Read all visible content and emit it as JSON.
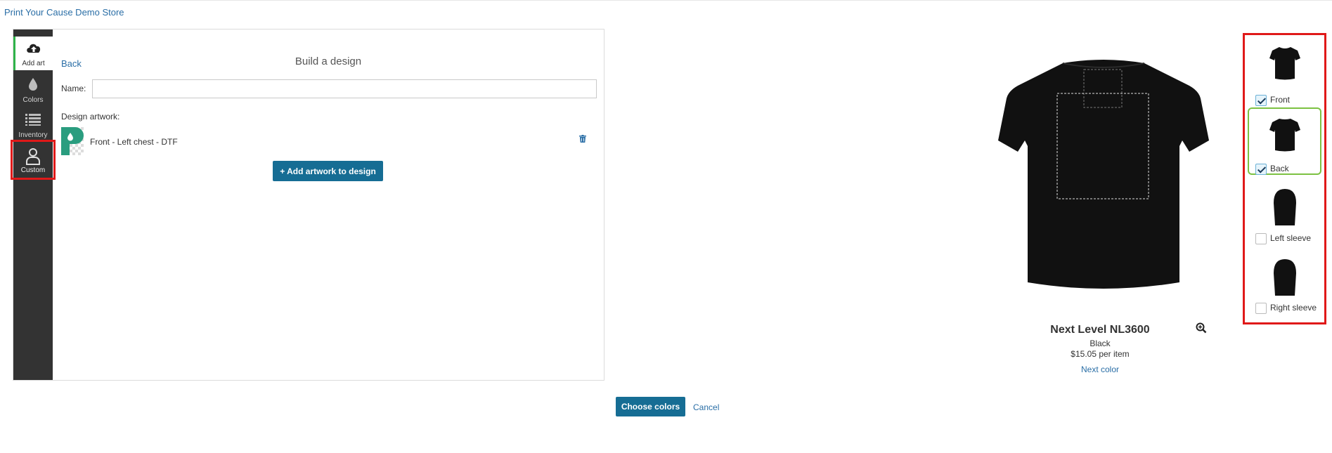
{
  "header": {
    "store_name": "Print Your Cause Demo Store"
  },
  "sidebar": {
    "items": [
      {
        "label": "Add art",
        "icon": "cloud-upload-icon",
        "active": true
      },
      {
        "label": "Colors",
        "icon": "ink-drop-icon",
        "active": false
      },
      {
        "label": "Inventory",
        "icon": "list-icon",
        "active": false
      },
      {
        "label": "Custom",
        "icon": "person-icon",
        "active": false
      }
    ]
  },
  "design": {
    "back_label": "Back",
    "title": "Build a design",
    "name_label": "Name:",
    "name_value": "",
    "artwork_label": "Design artwork:",
    "artworks": [
      {
        "name": "Front - Left chest - DTF"
      }
    ],
    "add_artwork_label": "Add artwork to design"
  },
  "footer": {
    "choose_colors_label": "Choose colors",
    "cancel_label": "Cancel"
  },
  "product": {
    "name": "Next Level NL3600",
    "color": "Black",
    "price": "$15.05 per item",
    "next_color_label": "Next color"
  },
  "views": [
    {
      "label": "Front",
      "checked": true,
      "selected": false
    },
    {
      "label": "Back",
      "checked": true,
      "selected": true
    },
    {
      "label": "Left sleeve",
      "checked": false,
      "selected": false
    },
    {
      "label": "Right sleeve",
      "checked": false,
      "selected": false
    }
  ],
  "colors": {
    "accent": "#166d94",
    "link": "#2a6ea6",
    "sidebar": "#333333",
    "highlight": "#e01919",
    "selected_view": "#7cc142"
  }
}
